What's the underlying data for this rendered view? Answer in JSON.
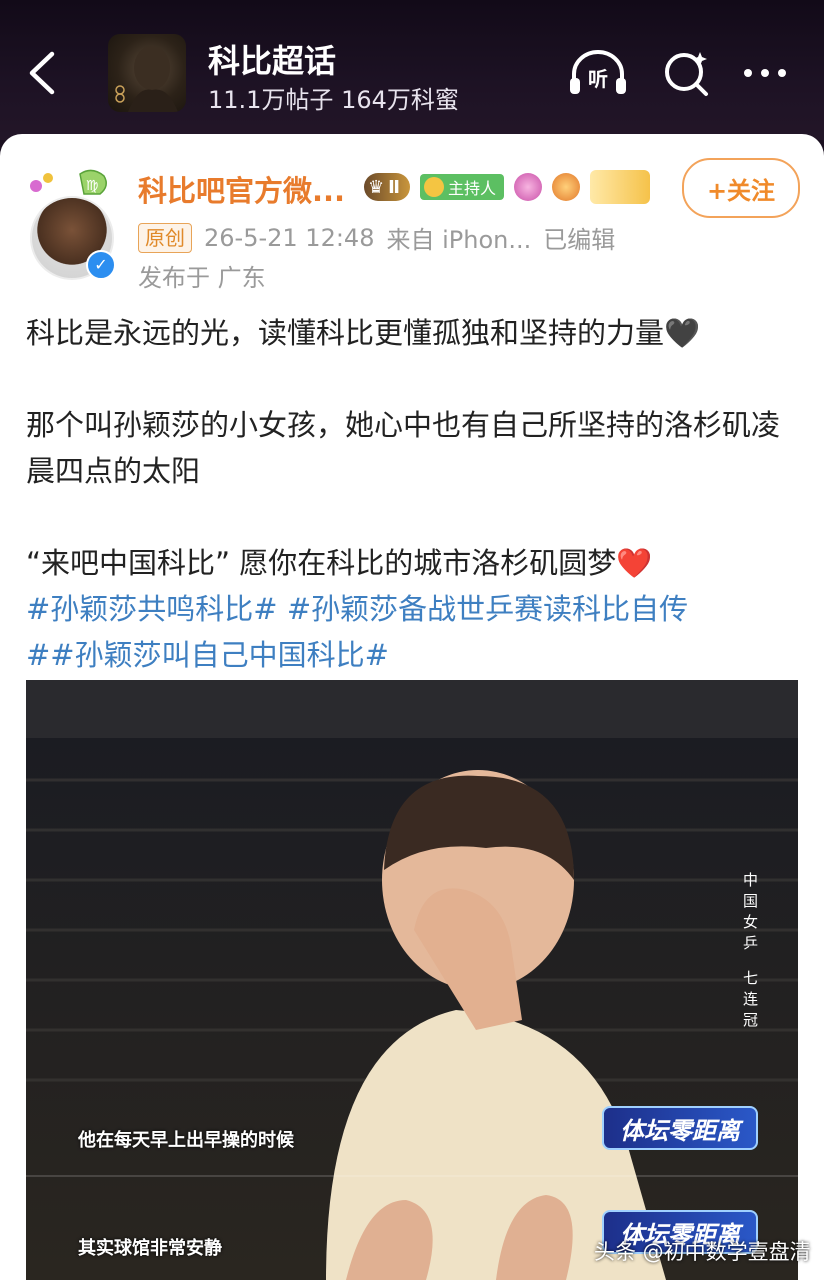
{
  "header": {
    "forum_title": "科比超话",
    "stats": "11.1万帖子 164万科蜜",
    "listen_label": "听",
    "icons": [
      "back-icon",
      "headphones-icon",
      "search-icon",
      "more-icon"
    ]
  },
  "post": {
    "author": "科比吧官方微...",
    "rank_badge": "Ⅱ",
    "host_badge": "主持人",
    "follow_label": "+关注",
    "original_tag": "原创",
    "datetime": "26-5-21 12:48",
    "source": "来自 iPhon...",
    "edited": "已编辑",
    "location": "发布于 广东",
    "paragraphs": [
      "科比是永远的光，读懂科比更懂孤独和坚持的力量🖤",
      "那个叫孙颖莎的小女孩，她心中也有自己所坚持的洛杉矶凌晨四点的太阳",
      "“来吧中国科比” 愿你在科比的城市洛杉矶圆梦❤️"
    ],
    "hashtags_line1": "#孙颖莎共鸣科比# #孙颖莎备战世乒赛读科比自传",
    "hashtags_line2": "##孙颖莎叫自己中国科比#"
  },
  "media": {
    "side_caption_1": "中国女乒",
    "side_caption_2": "七连冠",
    "subtitle_1": "他在每天早上出早操的时候",
    "subtitle_2": "其实球馆非常安静",
    "logo_text": "体坛零距离"
  },
  "watermark": "头条 @初中数学壹盘清",
  "colors": {
    "author": "#e87b2c",
    "hashtag": "#3e7fc1",
    "follow_border": "#f3a35a",
    "header_bg": "#1d1224"
  }
}
